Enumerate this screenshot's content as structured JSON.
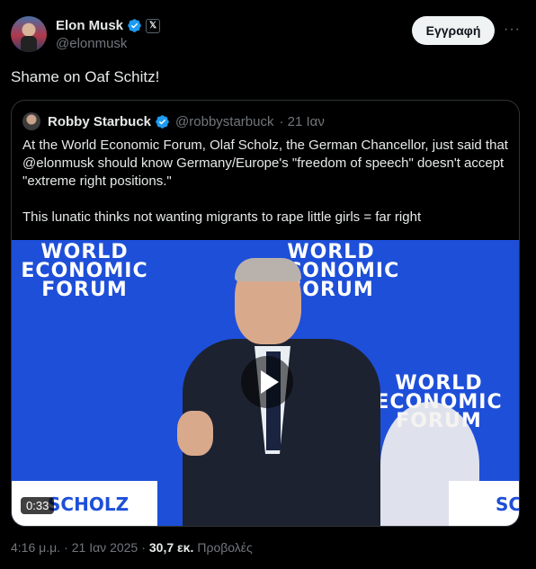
{
  "author": {
    "display_name": "Elon Musk",
    "handle": "@elonmusk",
    "badge_icon": "verified-badge-icon",
    "affiliation_icon": "x-logo-icon",
    "accent": "#1d9bf0"
  },
  "actions": {
    "subscribe_label": "Εγγραφή",
    "more_glyph": "···"
  },
  "tweet": {
    "text": "Shame on Oaf Schitz!"
  },
  "quote": {
    "display_name": "Robby Starbuck",
    "handle": "@robbystarbuck",
    "date": "· 21 Ιαν",
    "text": "At the World Economic Forum, Olaf Scholz, the German Chancellor, just said that @elonmusk should know Germany/Europe's \"freedom of speech\" doesn't accept \"extreme right positions.\"\n\nThis lunatic thinks not wanting migrants to rape little girls = far right",
    "video": {
      "duration": "0:33",
      "backdrop_text": [
        "WORLD",
        "ECONOMIC",
        "FORUM"
      ],
      "nameplate_1": "SCHOLZ",
      "nameplate_2": "SCH"
    }
  },
  "meta": {
    "time": "4:16 μ.μ.",
    "sep": "·",
    "date": "21 Ιαν 2025",
    "sep2": "·",
    "views_count": "30,7 εκ.",
    "views_label": "Προβολές"
  }
}
